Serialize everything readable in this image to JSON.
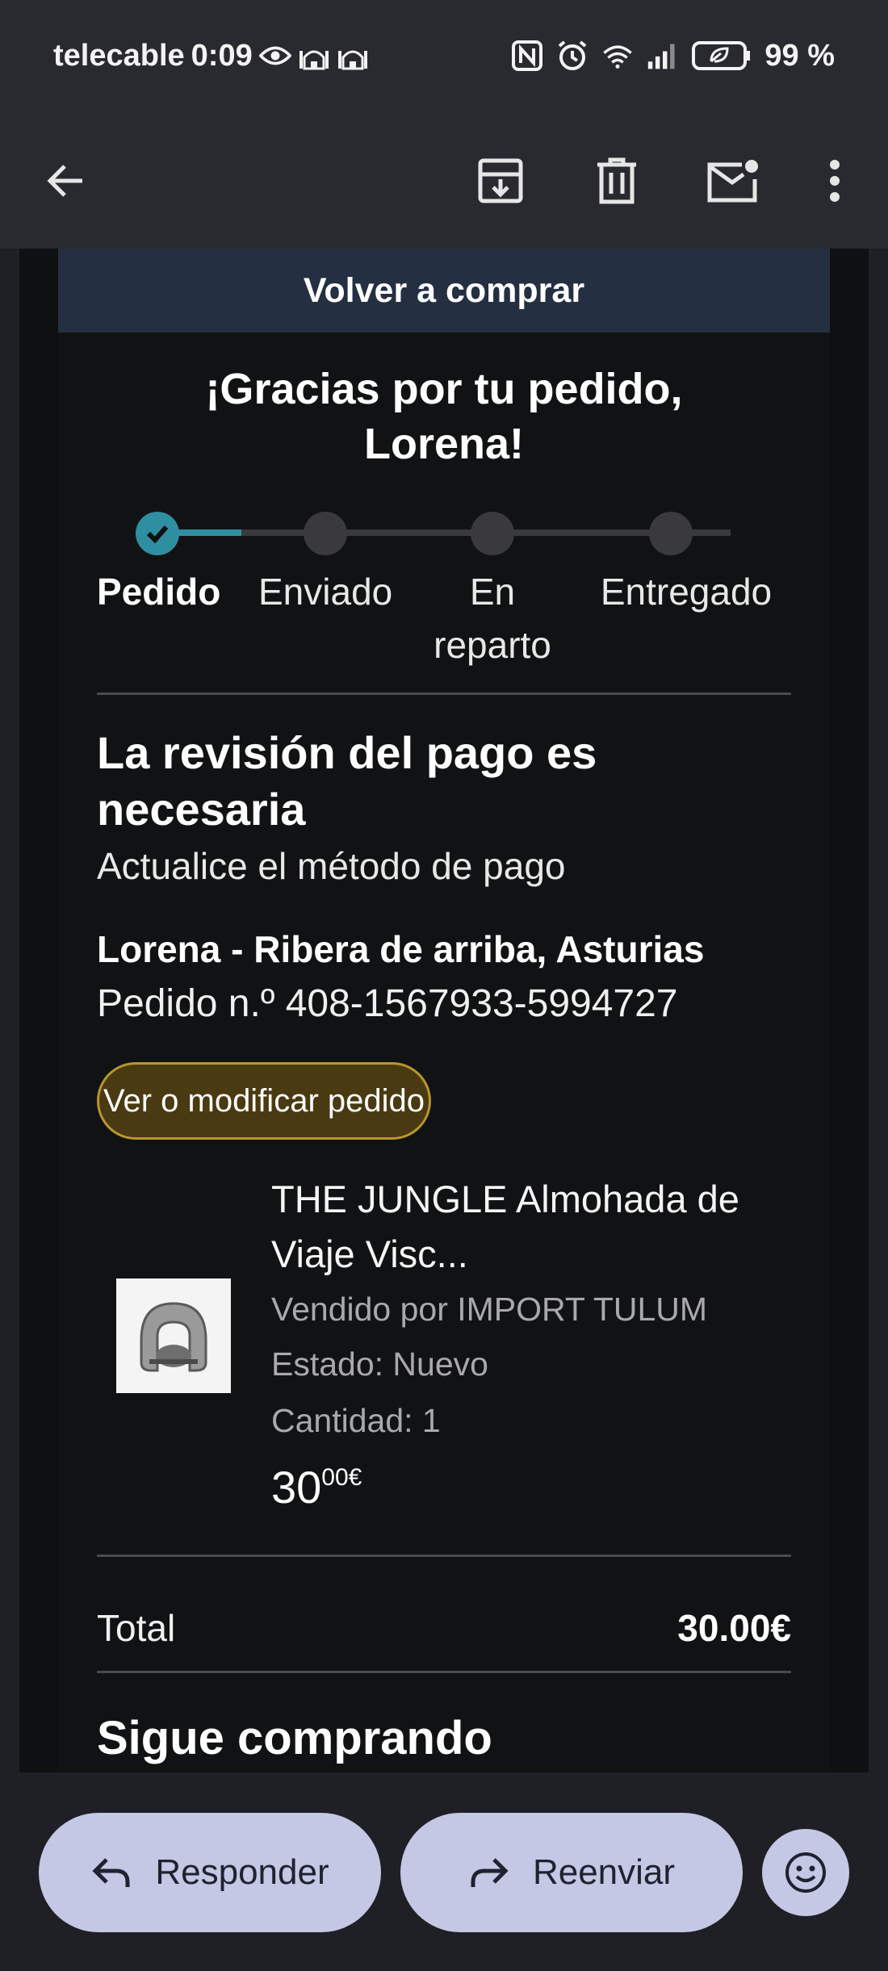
{
  "status_bar": {
    "carrier": "telecable",
    "time": "0:09",
    "battery": "99 %",
    "icons_left": [
      "eye-icon",
      "mosque-icon",
      "mosque-icon"
    ],
    "icons_right": [
      "nfc-icon",
      "alarm-icon",
      "wifi-6-icon",
      "signal-icon",
      "battery-saver-icon"
    ]
  },
  "app_bar": {
    "icons": [
      "back-arrow-icon",
      "archive-icon",
      "delete-icon",
      "mark-unread-icon",
      "more-vert-icon"
    ]
  },
  "email": {
    "banner_button": "Volver a comprar",
    "thanks_title": "¡Gracias por tu pedido, Lorena!",
    "tracker": {
      "steps": [
        "Pedido",
        "Enviado",
        "En reparto",
        "Entregado"
      ],
      "current_step_index": 0
    },
    "review_title": "La revisión del pago es necesaria",
    "review_subtitle": "Actualice el método de pago",
    "address": "Lorena - Ribera de arriba, Asturias",
    "order_number": "Pedido n.º 408-1567933-5994727",
    "view_order_button": "Ver o modificar pedido",
    "product": {
      "title": "THE JUNGLE Almohada de Viaje Visc...",
      "seller": "Vendido por IMPORT TULUM",
      "condition": "Estado: Nuevo",
      "quantity": "Cantidad: 1",
      "price_whole": "30",
      "price_fraction": "00€"
    },
    "total_label": "Total",
    "total_value": "30.00€",
    "more_section_title": "Sigue comprando"
  },
  "bottom_actions": {
    "reply_label": "Responder",
    "forward_label": "Reenviar",
    "emoji_icon": "emoji-reaction-icon"
  },
  "colors": {
    "accent_progress": "#2e8fa0",
    "banner_bg": "#243041",
    "view_button_bg": "#4a3a12",
    "view_button_border": "#b8962e",
    "pill_bg": "#c4c8e5"
  }
}
